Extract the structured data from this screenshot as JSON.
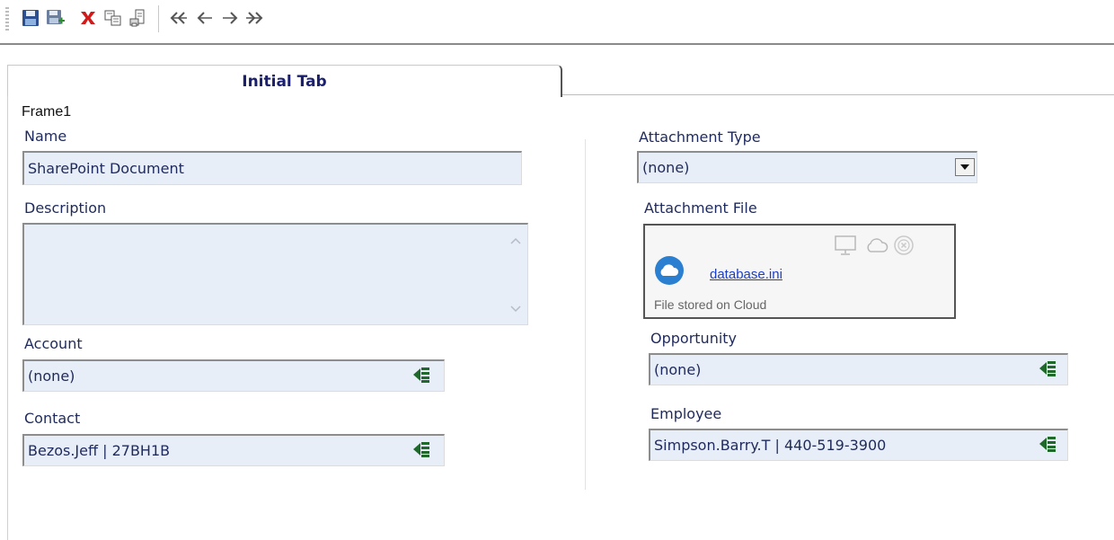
{
  "toolbar": {
    "buttons": [
      "save-icon",
      "save-new-icon",
      "delete-icon",
      "copy-icon",
      "print-icon",
      "first-record-icon",
      "previous-record-icon",
      "next-record-icon",
      "last-record-icon"
    ]
  },
  "tabs": {
    "active_label": "Initial Tab"
  },
  "frame": {
    "label": "Frame1"
  },
  "form": {
    "name_label": "Name",
    "name_value": "SharePoint Document",
    "description_label": "Description",
    "description_value": "",
    "account_label": "Account",
    "account_value": "(none)",
    "contact_label": "Contact",
    "contact_value": "Bezos.Jeff | 27BH1B",
    "attachment_type_label": "Attachment Type",
    "attachment_type_value": "(none)",
    "attachment_file_label": "Attachment File",
    "attachment_file_name": "database.ini",
    "attachment_file_note": "File stored on Cloud",
    "opportunity_label": "Opportunity",
    "opportunity_value": "(none)",
    "employee_label": "Employee",
    "employee_value": "Simpson.Barry.T | 440-519-3900"
  },
  "colors": {
    "field_bg": "#e7eef8",
    "label_text": "#1f2a5c",
    "tab_text": "#1a1f6e",
    "delete_red": "#d11a1a",
    "cloud_blue": "#2b7fd1",
    "link_blue": "#1a3ec9"
  }
}
